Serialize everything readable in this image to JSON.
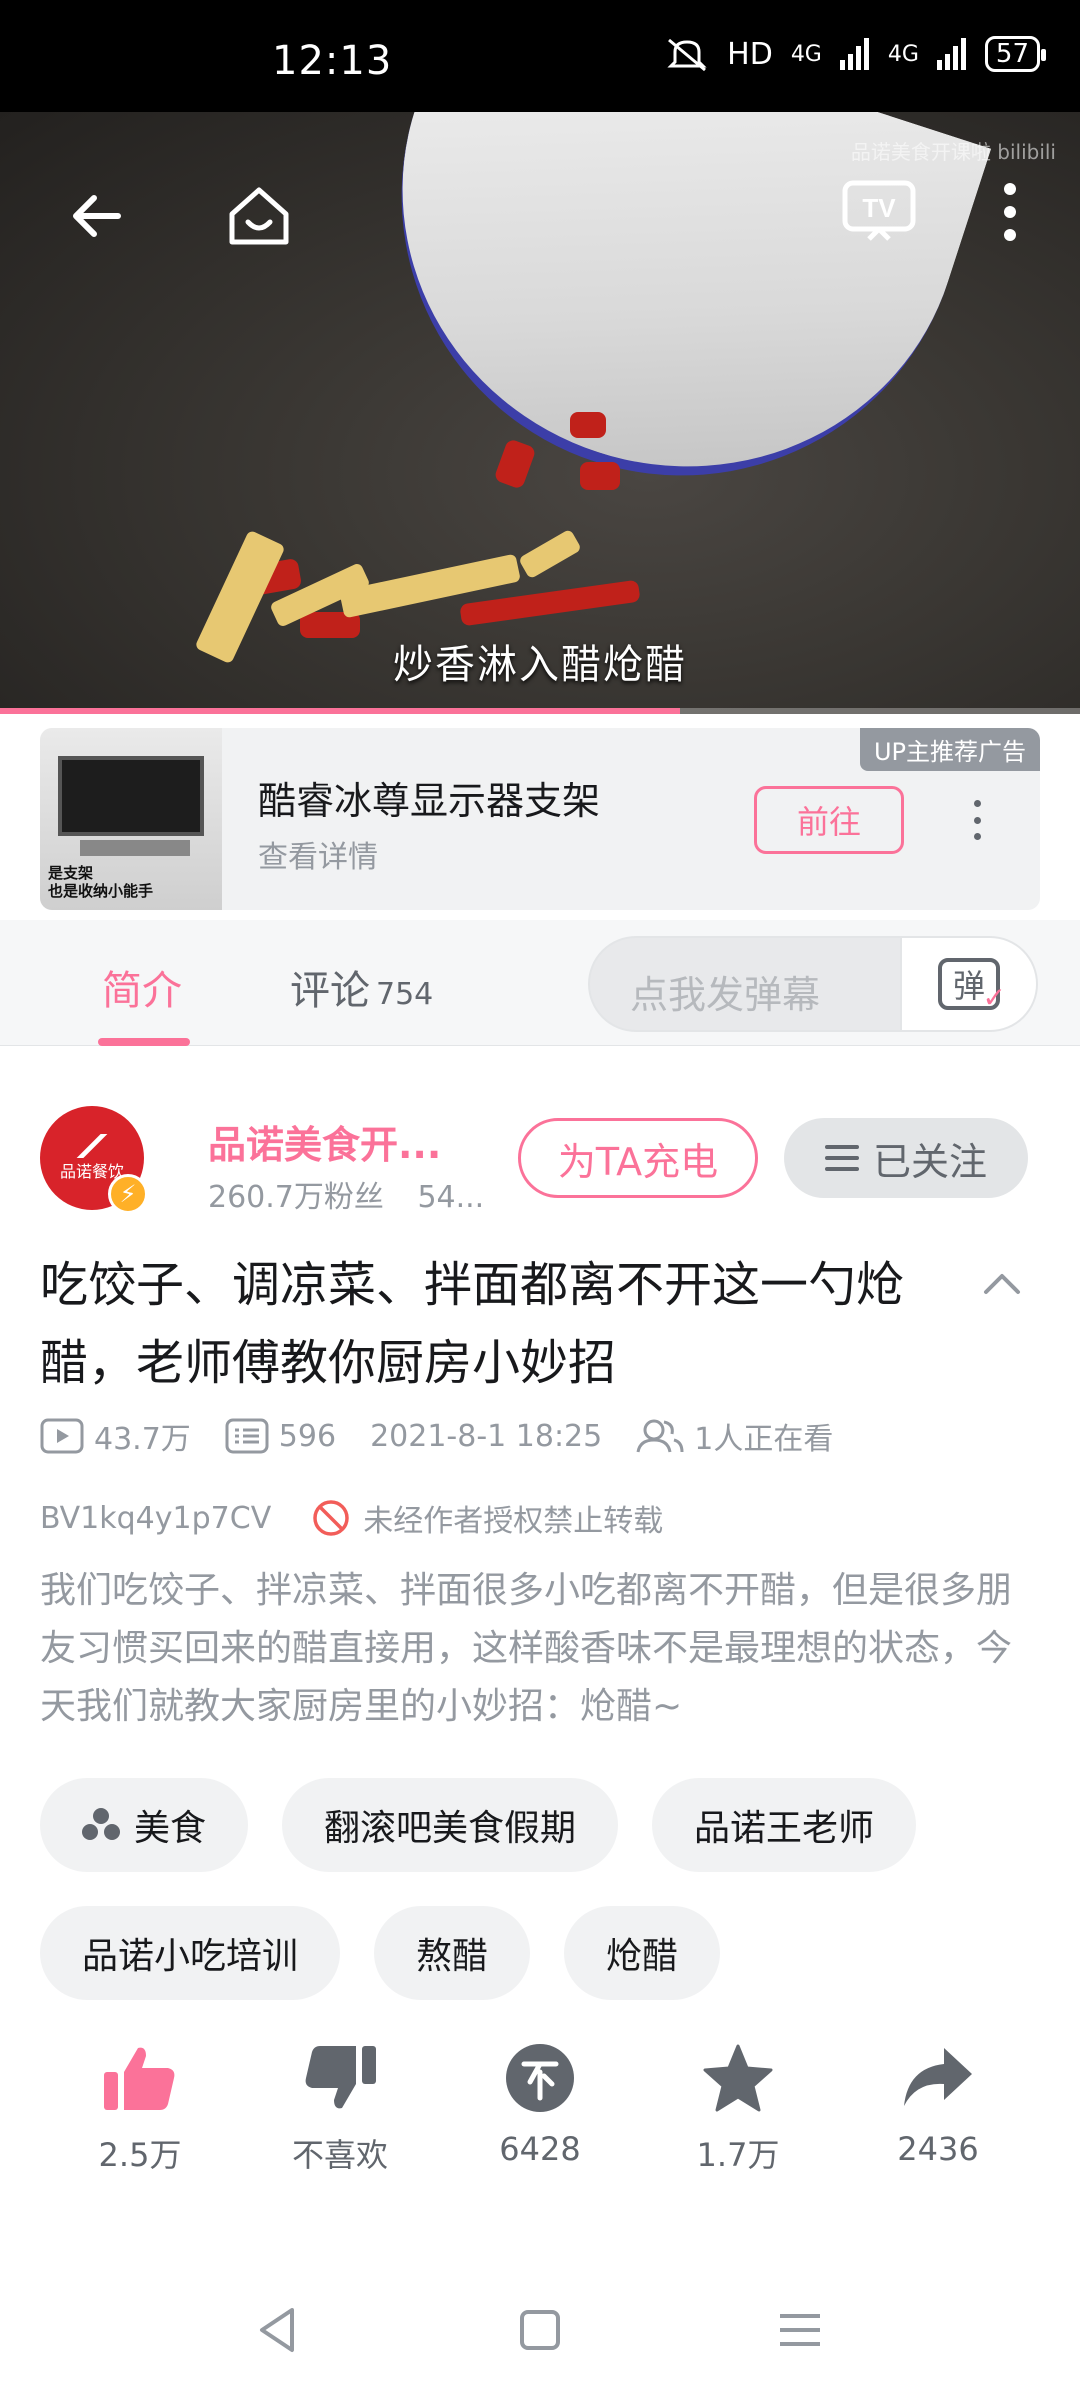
{
  "status_bar": {
    "time": "12:13",
    "hd": "HD",
    "net1": "4G",
    "net2": "4G",
    "battery": "57"
  },
  "video": {
    "watermark": "品诺美食开课啦 bilibili",
    "subtitle": "炒香淋入醋炝醋",
    "progress_fraction": 0.63
  },
  "ad": {
    "badge": "UP主推荐广告",
    "title": "酷睿冰尊显示器支架",
    "subtitle": "查看详情",
    "go_label": "前往",
    "thumb_caption_1": "是支架",
    "thumb_caption_2": "也是收纳小能手"
  },
  "tabs": {
    "intro": "简介",
    "comments": "评论",
    "comments_count": "754",
    "danmaku_placeholder": "点我发弹幕",
    "danmaku_btn": "弹"
  },
  "uploader": {
    "name": "品诺美食开...",
    "fans": "260.7万粉丝",
    "videos": "54...",
    "avatar_text": "品诺餐饮",
    "charge_label": "为TA充电",
    "follow_label": "已关注"
  },
  "video_info": {
    "title": "吃饺子、调凉菜、拌面都离不开这一勺炝醋，老师傅教你厨房小妙招",
    "plays": "43.7万",
    "danmaku_count": "596",
    "date": "2021-8-1 18:25",
    "watching": "1人正在看",
    "bvid": "BV1kq4y1p7CV",
    "copyright": "未经作者授权禁止转载",
    "description": "我们吃饺子、拌凉菜、拌面很多小吃都离不开醋，但是很多朋友习惯买回来的醋直接用，这样酸香味不是最理想的状态，今天我们就教大家厨房里的小妙招：炝醋~"
  },
  "tags": [
    "美食",
    "翻滚吧美食假期",
    "品诺王老师",
    "品诺小吃培训",
    "熬醋",
    "炝醋"
  ],
  "actions": {
    "like": "2.5万",
    "dislike": "不喜欢",
    "coin": "6428",
    "favorite": "1.7万",
    "share": "2436"
  },
  "colors": {
    "accent": "#fb7299",
    "gray": "#9499a0"
  }
}
